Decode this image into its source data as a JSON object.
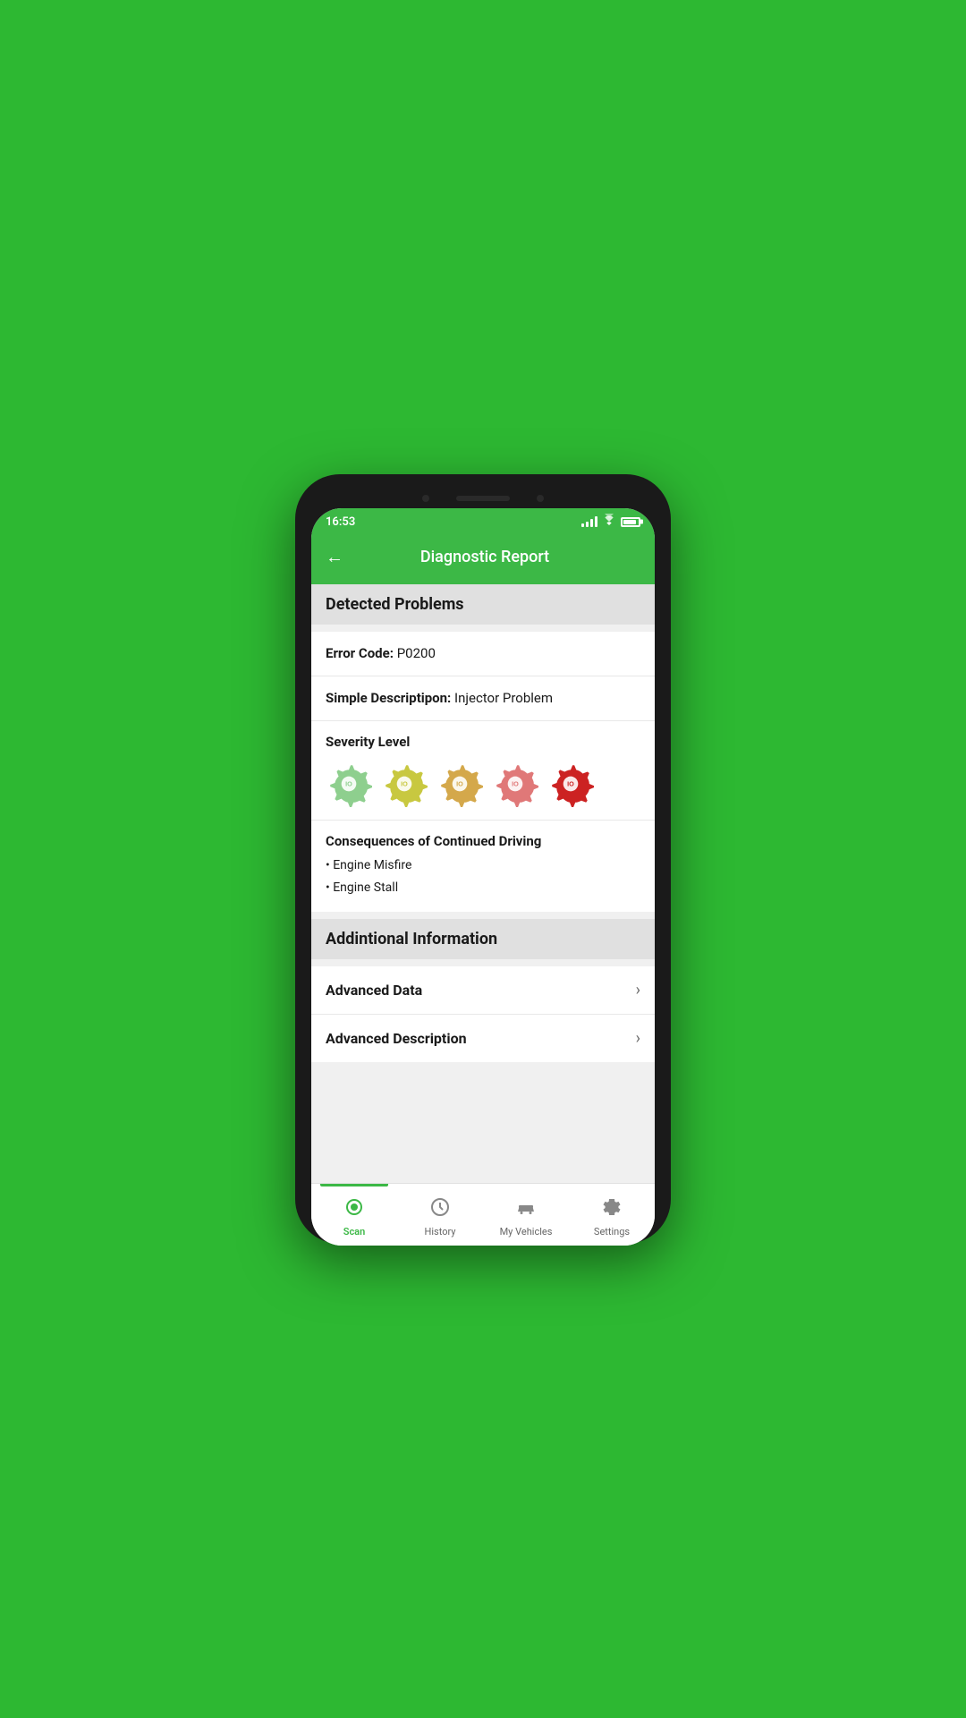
{
  "statusBar": {
    "time": "16:53"
  },
  "header": {
    "title": "Diagnostic Report",
    "backLabel": "←"
  },
  "detectedProblems": {
    "sectionTitle": "Detected Problems",
    "errorCodeLabel": "Error Code:",
    "errorCodeValue": "P0200",
    "simpleDescLabel": "Simple Descriptipon:",
    "simpleDescValue": "Injector Problem",
    "severityTitle": "Severity Level",
    "severityLevel": 5,
    "consequencesTitle": "Consequences of Continued Driving",
    "consequences": [
      "Engine Misfire",
      "Engine Stall"
    ]
  },
  "additionalInfo": {
    "sectionTitle": "Addintional Information",
    "items": [
      {
        "label": "Advanced Data",
        "id": "advanced-data"
      },
      {
        "label": "Advanced Description",
        "id": "advanced-description"
      }
    ]
  },
  "bottomNav": {
    "items": [
      {
        "label": "Scan",
        "icon": "⊙",
        "active": true,
        "id": "scan"
      },
      {
        "label": "History",
        "icon": "⏱",
        "active": false,
        "id": "history"
      },
      {
        "label": "My Vehicles",
        "icon": "🚗",
        "active": false,
        "id": "my-vehicles"
      },
      {
        "label": "Settings",
        "icon": "⚙",
        "active": false,
        "id": "settings"
      }
    ]
  },
  "gearColors": [
    "#8ecf8e",
    "#c8c840",
    "#d4a84b",
    "#e07878",
    "#cc2222"
  ]
}
